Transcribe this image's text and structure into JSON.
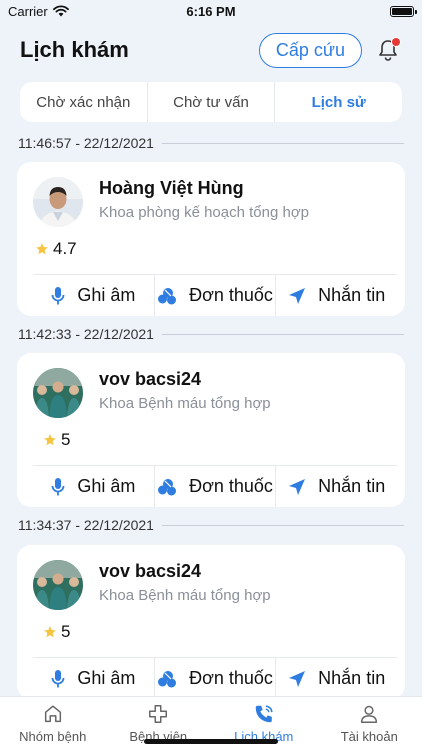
{
  "status_bar": {
    "carrier": "Carrier",
    "time": "6:16 PM"
  },
  "header": {
    "title": "Lịch khám",
    "emergency_label": "Cấp cứu"
  },
  "tabs": [
    {
      "label": "Chờ xác nhận",
      "active": false
    },
    {
      "label": "Chờ tư vấn",
      "active": false
    },
    {
      "label": "Lịch sử",
      "active": true
    }
  ],
  "appointments": [
    {
      "timestamp": "11:46:57 - 22/12/2021",
      "doctor_name": "Hoàng Việt Hùng",
      "department": "Khoa phòng kế hoạch tổng hợp",
      "rating": "4.7",
      "avatar": "doctor-photo"
    },
    {
      "timestamp": "11:42:33 - 22/12/2021",
      "doctor_name": "vov bacsi24",
      "department": "Khoa Bệnh máu tổng hợp",
      "rating": "5",
      "avatar": "medical-team-photo"
    },
    {
      "timestamp": "11:34:37 - 22/12/2021",
      "doctor_name": "vov bacsi24",
      "department": "Khoa Bệnh máu tổng hợp",
      "rating": "5",
      "avatar": "medical-team-photo"
    }
  ],
  "actions": {
    "record": {
      "label": "Ghi âm",
      "icon": "microphone-icon"
    },
    "prescription": {
      "label": "Đơn thuốc",
      "icon": "pills-icon"
    },
    "message": {
      "label": "Nhắn tin",
      "icon": "send-icon"
    }
  },
  "bottom_nav": [
    {
      "label": "Nhóm bệnh",
      "icon": "home-icon",
      "active": false
    },
    {
      "label": "Bệnh viện",
      "icon": "medical-cross-icon",
      "active": false
    },
    {
      "label": "Lịch khám",
      "icon": "phone-icon",
      "active": true
    },
    {
      "label": "Tài khoản",
      "icon": "user-icon",
      "active": false
    }
  ],
  "colors": {
    "accent": "#2f7de1",
    "background": "#eef3fa",
    "star": "#f5c542",
    "notification_dot": "#e53935"
  }
}
